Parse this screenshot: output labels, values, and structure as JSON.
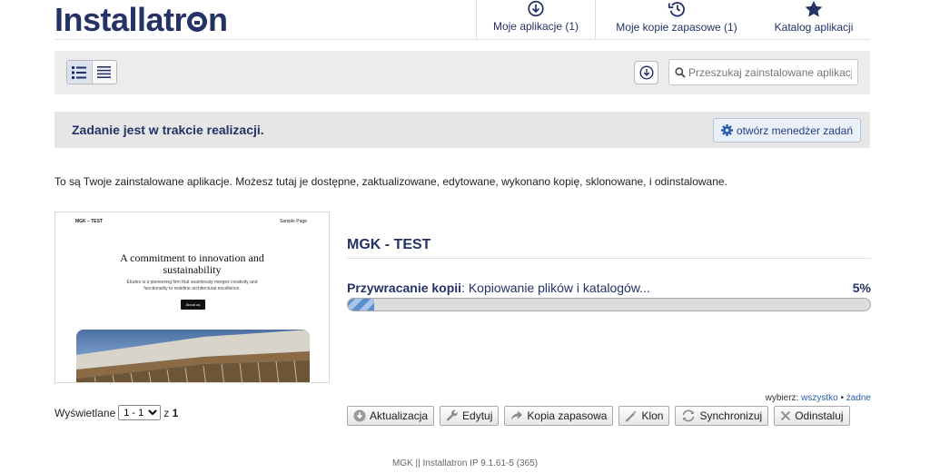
{
  "brand": {
    "logo_pre": "Installatr",
    "logo_post": "n"
  },
  "tabs": [
    {
      "label": "Moje aplikacje (1)",
      "icon": "download-circle-icon",
      "active": true
    },
    {
      "label": "Moje kopie zapasowe (1)",
      "icon": "history-clock-icon",
      "active": false
    },
    {
      "label": "Katalog aplikacji",
      "icon": "star-icon",
      "active": false
    }
  ],
  "toolbar": {
    "search_placeholder": "Przeszukaj zainstalowane aplikacje"
  },
  "banner": {
    "text": "Zadanie jest w trakcie realizacji.",
    "button_label": "otwórz menedżer zadań"
  },
  "intro": "To są Twoje zainstalowane aplikacje. Możesz tutaj je dostępne, zaktualizowane, edytowane, wykonano kopię, sklonowane, i odinstalowane.",
  "app": {
    "title": "MGK - TEST",
    "status_label": "Przywracanie kopii",
    "status_sep": ":",
    "status_detail": " Kopiowanie plików i katalogów...",
    "percent_text": "5%",
    "progress": 0.05,
    "preview": {
      "brand": "MGK – TEST",
      "nav": "Sample Page",
      "heading": "A commitment to innovation and sustainability",
      "sub": "Études is a pioneering firm that seamlessly merges creativity and functionality to redefine architectural excellence.",
      "button": "About us"
    }
  },
  "pagination": {
    "label": "Wyświetlane",
    "selected": "1 - 1",
    "of": "z",
    "total": "1"
  },
  "select": {
    "label": "wybierz:",
    "all": "wszystko",
    "sep": "•",
    "none": "żadne"
  },
  "actions": [
    {
      "name": "update-button",
      "label": "Aktualizacja",
      "icon": "download-circle-icon"
    },
    {
      "name": "edit-button",
      "label": "Edytuj",
      "icon": "wrench-icon"
    },
    {
      "name": "backup-button",
      "label": "Kopia zapasowa",
      "icon": "share-arrow-icon"
    },
    {
      "name": "clone-button",
      "label": "Klon",
      "icon": "wand-icon"
    },
    {
      "name": "sync-button",
      "label": "Synchronizuj",
      "icon": "sync-icon"
    },
    {
      "name": "uninstall-button",
      "label": "Odinstaluj",
      "icon": "close-icon"
    }
  ],
  "footer": {
    "site": "MGK",
    "sep": "||",
    "version": "Installatron IP 9.1.61-5 (365)"
  },
  "colors": {
    "brand": "#243266",
    "link": "#2a5db0",
    "progress": "#5b8fd0"
  }
}
